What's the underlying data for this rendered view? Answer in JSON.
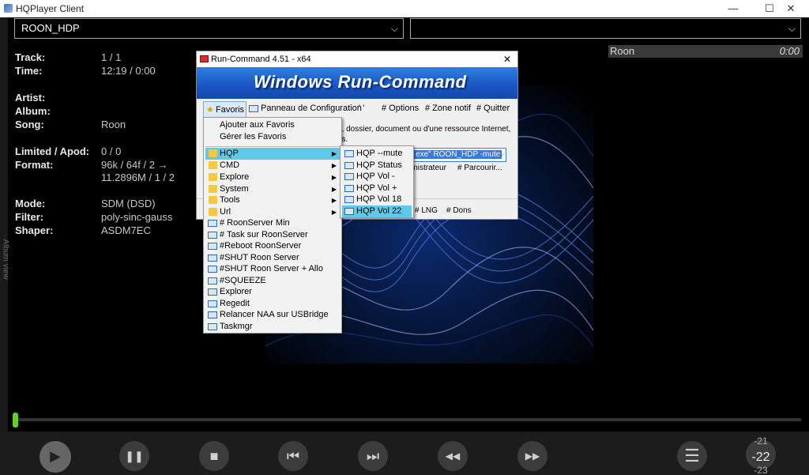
{
  "window": {
    "title": "HQPlayer Client",
    "minimize": "—",
    "maximize": "☐",
    "close": "✕"
  },
  "sidebar": {
    "label": "Album view"
  },
  "devices": {
    "left_value": "ROON_HDP",
    "right_value": ""
  },
  "track_info": {
    "track_label": "Track:",
    "track_value": "1 / 1",
    "time_label": "Time:",
    "time_value": "12:19 / 0:00",
    "artist_label": "Artist:",
    "artist_value": "",
    "album_label": "Album:",
    "album_value": "",
    "song_label": "Song:",
    "song_value": "Roon",
    "limited_label": "Limited / Apod:",
    "limited_value": "0 / 0",
    "format_label": "Format:",
    "format_value_1": "96k / 64f / 2 →",
    "format_value_2": "11.2896M / 1 / 2",
    "mode_label": "Mode:",
    "mode_value": "SDM (DSD)",
    "filter_label": "Filter:",
    "filter_value": "poly-sinc-gauss",
    "shaper_label": "Shaper:",
    "shaper_value": "ASDM7EC"
  },
  "playlist": {
    "item": "Roon",
    "duration": "0:00"
  },
  "volume": {
    "above": "-21",
    "current": "-22",
    "below": "-23"
  },
  "controls": {
    "play": "▶",
    "pause": "❚❚",
    "stop": "■",
    "prev": "⏮",
    "next": "⏭",
    "rewind": "◀◀",
    "forward": "▶▶",
    "menu": "☰"
  },
  "runcommand": {
    "title": "Run-Command 4.51 - x64",
    "close": "✕",
    "banner": "Windows Run-Command",
    "fav_button": "Favoris",
    "menu_panneau": "Panneau de Configuration",
    "menu_dots": "'     '",
    "menu_options": "# Options",
    "menu_zone": "# Zone notif",
    "menu_quitter": "# Quitter",
    "desc_line1": "e, dossier, document ou d'une ressource Internet,",
    "desc_line2": "us.",
    "combo_value": "exe\" ROON_HDP -mute",
    "admin_text": "inistrateur",
    "parcourir": "# Parcourir...",
    "lng": "# LNG",
    "dons": "# Dons"
  },
  "fav_menu": {
    "top": [
      "Ajouter aux Favoris",
      "Gérer les Favoris"
    ],
    "folders": [
      "HQP",
      "CMD",
      "Explore",
      "System",
      "Tools",
      "Url"
    ],
    "commands": [
      "# RoonServer Min",
      "# Task sur RoonServer",
      "#Reboot RoonServer",
      "#SHUT Roon Server",
      "#SHUT Roon Server + Allo",
      "#SQUEEZE",
      "Explorer",
      "Regedit",
      "Relancer NAA sur USBridge",
      "Taskmgr"
    ]
  },
  "hqp_submenu": [
    "HQP --mute",
    "HQP Status",
    "HQP Vol -",
    "HQP Vol +",
    "HQP Vol 18",
    "HQP Vol 22"
  ],
  "colors": {
    "accent": "#60c8e8",
    "seek": "#5fd12e",
    "banner": "#1a55c4"
  }
}
